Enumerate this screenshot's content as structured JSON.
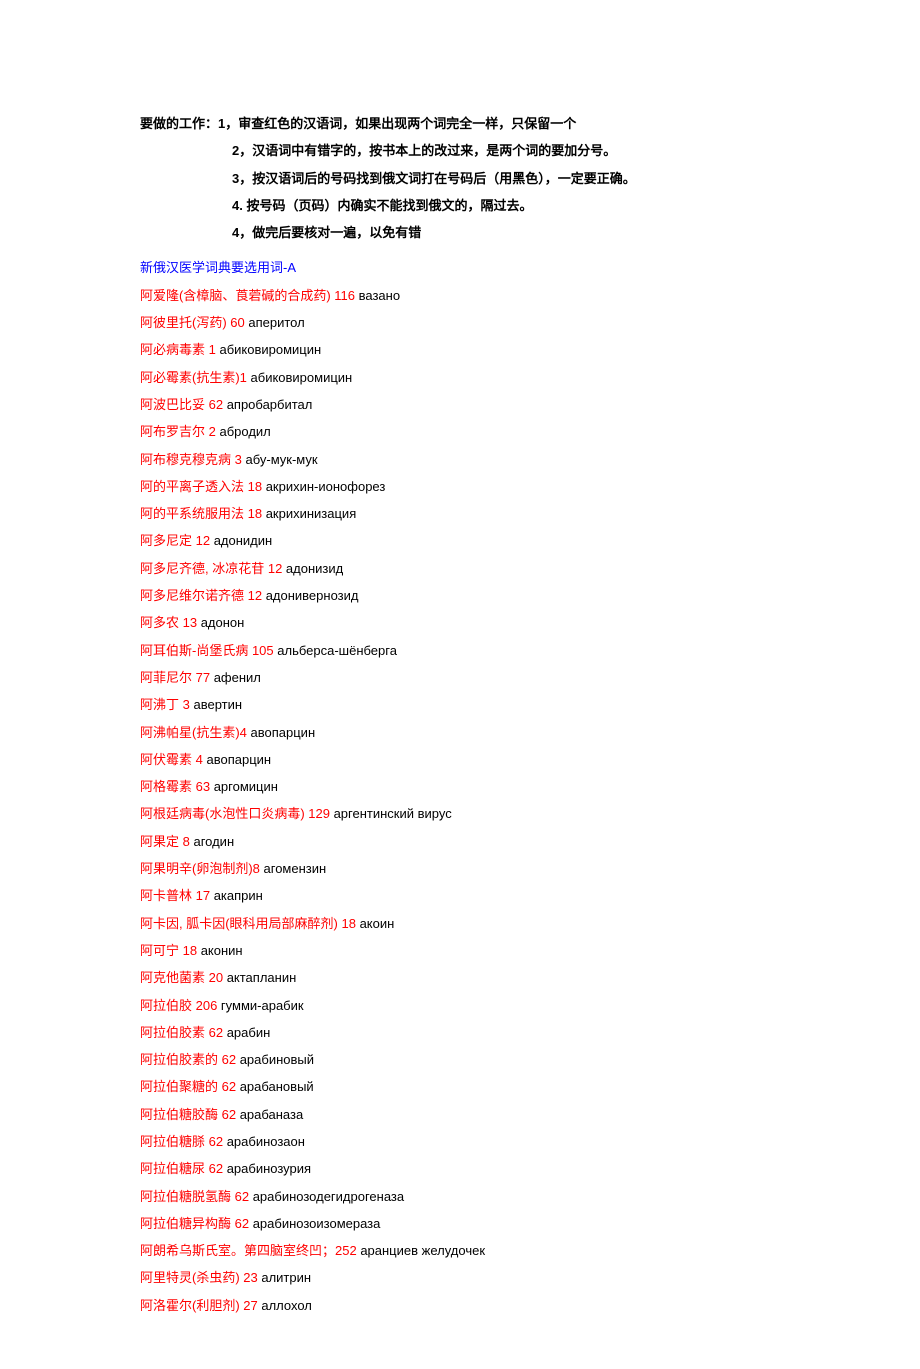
{
  "instructions": {
    "line1": "要做的工作：1，审查红色的汉语词，如果出现两个词完全一样，只保留一个",
    "line2": "2，汉语词中有错字的，按书本上的改过来，是两个词的要加分号。",
    "line3": "3，按汉语词后的号码找到俄文词打在号码后（用黑色），一定要正确。",
    "line4": "4. 按号码（页码）内确实不能找到俄文的，隔过去。",
    "line5": "4，做完后要核对一遍，以免有错"
  },
  "title": "新俄汉医学词典要选用词-A",
  "entries": [
    {
      "chinese": "阿爱隆(含樟脑、莨菪碱的合成药)  116 ",
      "russian": "вазано"
    },
    {
      "chinese": "阿彼里托(泻药)   60 ",
      "russian": "аперитол"
    },
    {
      "chinese": "阿必病毒素 1 ",
      "russian": "абиковиромицин"
    },
    {
      "chinese": "阿必霉素(抗生素)1 ",
      "russian": "абиковиромицин"
    },
    {
      "chinese": "阿波巴比妥 62  ",
      "russian": "апробарбитал"
    },
    {
      "chinese": "阿布罗吉尔 2 ",
      "russian": "абродил"
    },
    {
      "chinese": "阿布穆克穆克病 3 ",
      "russian": "абу-мук-мук"
    },
    {
      "chinese": "阿的平离子透入法 18 ",
      "russian": "акрихин-ионофорез"
    },
    {
      "chinese": "阿的平系统服用法 18 ",
      "russian": "акрихинизация"
    },
    {
      "chinese": "阿多尼定 12 ",
      "russian": "адонидин"
    },
    {
      "chinese": "阿多尼齐德, 冰凉花苷 12  ",
      "russian": "адонизид"
    },
    {
      "chinese": "阿多尼维尔诺齐德 12 ",
      "russian": "адонивернозид"
    },
    {
      "chinese": "阿多农 13 ",
      "russian": "адонон"
    },
    {
      "chinese": "阿耳伯斯-尚堡氏病 105 ",
      "russian": "альберса-шёнберга"
    },
    {
      "chinese": "阿菲尼尔 77 ",
      "russian": "афенил"
    },
    {
      "chinese": "阿沸丁 3 ",
      "russian": "авертин"
    },
    {
      "chinese": "阿沸帕星(抗生素)4 ",
      "russian": "авопарцин"
    },
    {
      "chinese": "阿伏霉素 4  ",
      "russian": "авопарцин"
    },
    {
      "chinese": "阿格霉素 63 ",
      "russian": "аргомицин"
    },
    {
      "chinese": "阿根廷病毒(水泡性口炎病毒)  129 ",
      "russian": "аргентинский вирус"
    },
    {
      "chinese": "阿果定 8 ",
      "russian": "агодин"
    },
    {
      "chinese": "阿果明辛(卵泡制剂)8 ",
      "russian": "агомензин"
    },
    {
      "chinese": "阿卡普林 17 ",
      "russian": "акаприн"
    },
    {
      "chinese": "阿卡因, 胍卡因(眼科用局部麻醉剂)  18 ",
      "russian": "акоин"
    },
    {
      "chinese": "阿可宁 18 ",
      "russian": "аконин"
    },
    {
      "chinese": "阿克他菌素 20 ",
      "russian": "актапланин"
    },
    {
      "chinese": "阿拉伯胶 206 ",
      "russian": "гумми-арабик"
    },
    {
      "chinese": "阿拉伯胶素 62 ",
      "russian": "арабин"
    },
    {
      "chinese": "阿拉伯胶素的 62 ",
      "russian": "арабиновый"
    },
    {
      "chinese": "阿拉伯聚糖的 62 ",
      "russian": "арабановый"
    },
    {
      "chinese": "阿拉伯糖胶酶 62 ",
      "russian": "арабаназа"
    },
    {
      "chinese": "阿拉伯糖脎 62 ",
      "russian": "арабинозаон"
    },
    {
      "chinese": "阿拉伯糖尿 62 ",
      "russian": "арабинозурия"
    },
    {
      "chinese": "阿拉伯糖脱氢酶 62 ",
      "russian": "арабинозодегидрогеназа"
    },
    {
      "chinese": "阿拉伯糖异构酶 62 ",
      "russian": "арабинозоизомераза"
    },
    {
      "chinese": "阿朗希乌斯氏室。第四脑室终凹；252 ",
      "russian": "аранциев желудочек"
    },
    {
      "chinese": "阿里特灵(杀虫药)  23 ",
      "russian": "алитрин"
    },
    {
      "chinese": "阿洛霍尔(利胆剂)  27 ",
      "russian": "аллохол"
    }
  ]
}
